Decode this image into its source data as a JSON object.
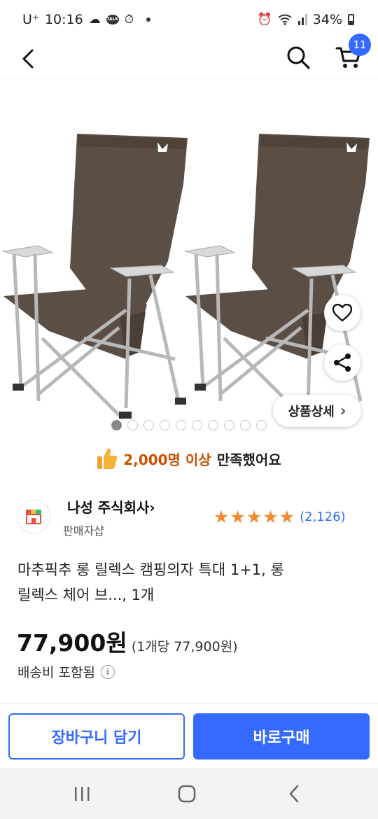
{
  "status_bar": {
    "carrier": "U⁺",
    "time": "10:16",
    "battery": "34%",
    "icons": [
      "cloud-icon",
      "kakaotalk-icon",
      "timer-icon",
      "alarm-icon",
      "wifi-icon",
      "signal-icon",
      "battery-icon"
    ],
    "talk_label": "TALK"
  },
  "header": {
    "cart_count": "11",
    "icons": [
      "back-arrow-icon",
      "search-icon",
      "cart-icon"
    ]
  },
  "gallery": {
    "detail_button_label": "상품상세",
    "detail_chevron": "›",
    "total_images": 10,
    "active_index": 0,
    "icons": [
      "heart-icon",
      "share-icon"
    ]
  },
  "satisfaction": {
    "highlight": "2,000명 이상",
    "rest": "만족했어요",
    "icon": "thumbs-up-icon"
  },
  "seller": {
    "name": "나성 주식회사",
    "chevron": "›",
    "sub_label": "판매자샵",
    "rating": 5,
    "review_count": "(2,126)",
    "icon": "shop-icon"
  },
  "product": {
    "title_line1": "마추픽추 롱 릴렉스 캠핑의자 특대 1+1, 롱",
    "title_line2": "릴렉스 체어 브..., 1개",
    "price": "77,900원",
    "unit_price": "(1개당 77,900원)",
    "shipping": "배송비 포함됨",
    "info_glyph": "i"
  },
  "actions": {
    "add_to_cart": "장바구니 담기",
    "buy_now": "바로구매"
  },
  "colors": {
    "accent": "#346aff",
    "satisfaction_highlight": "#cc4f00",
    "star": "#f08a2c",
    "chair_fabric": "#5b4e45"
  },
  "system_nav": {
    "icons": [
      "recent-apps-icon",
      "home-icon",
      "back-nav-icon"
    ]
  }
}
